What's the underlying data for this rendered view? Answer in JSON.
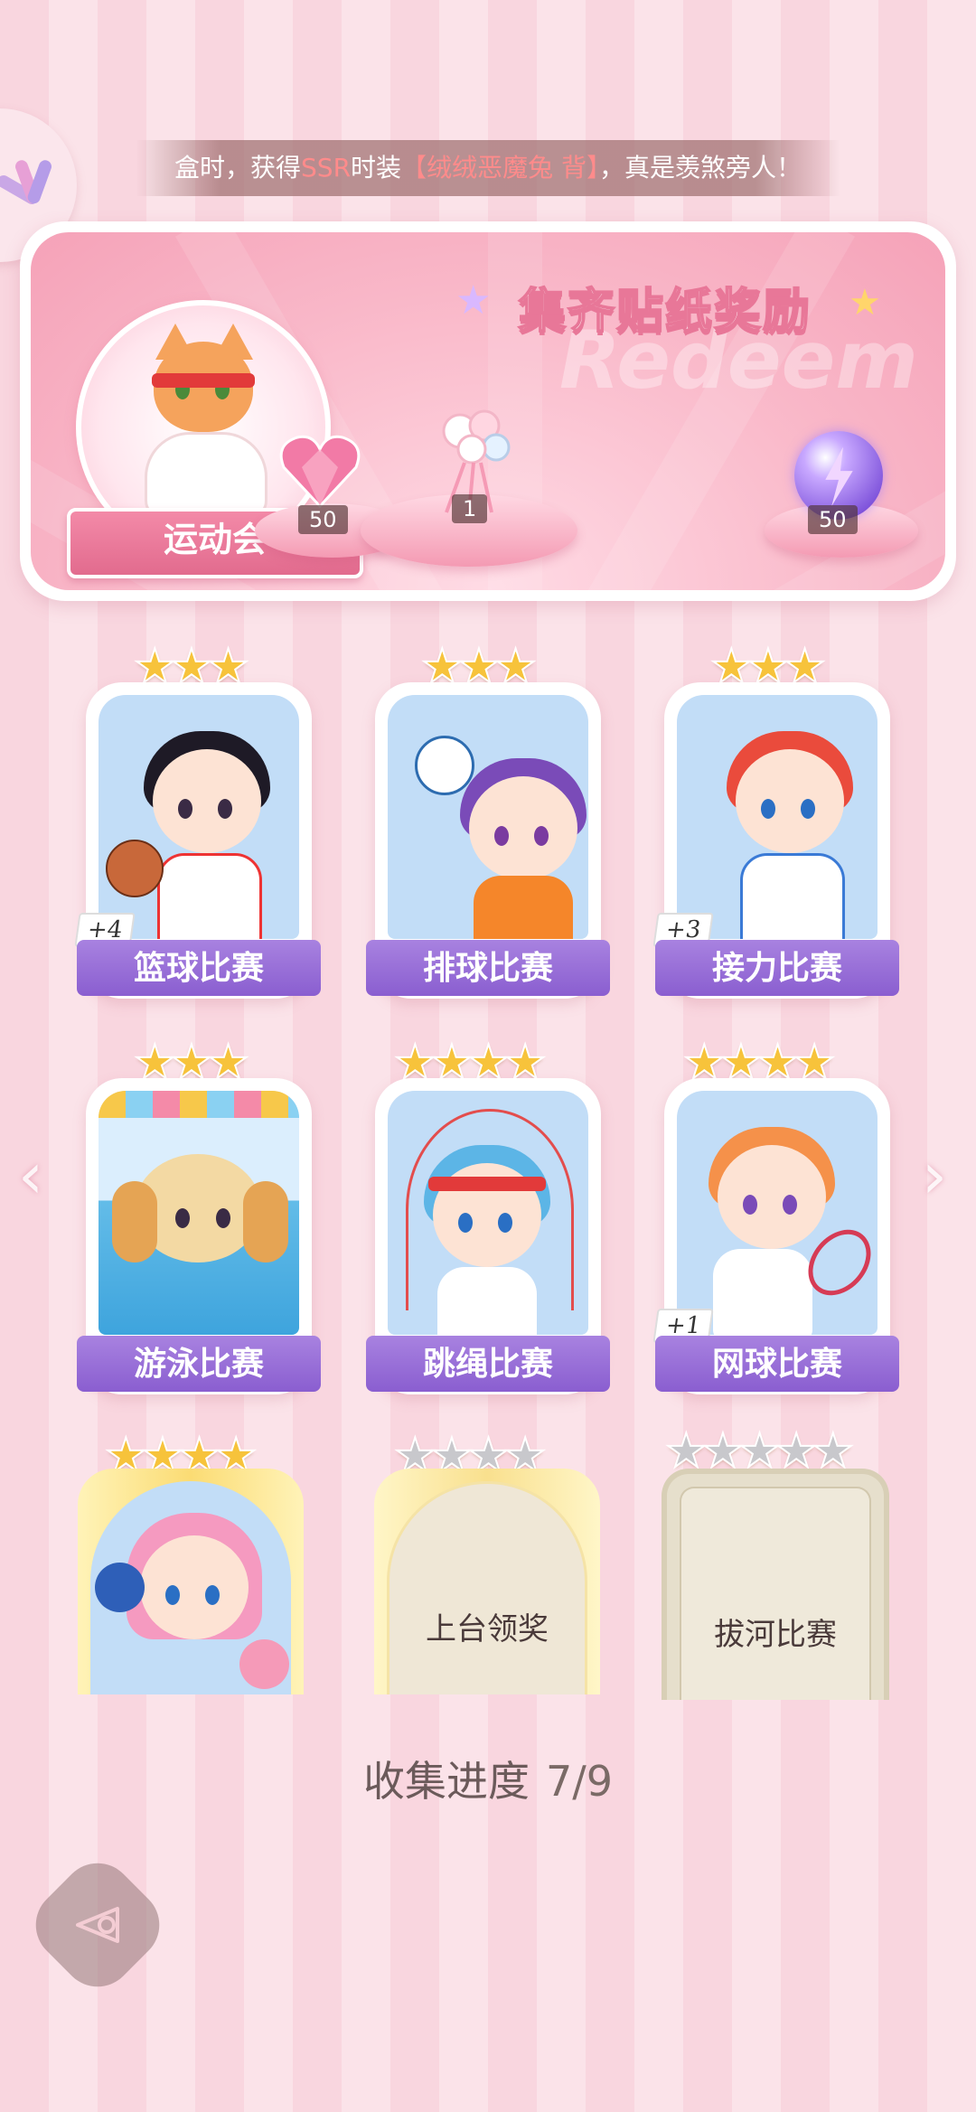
{
  "ticker": {
    "part1": "盒时，获得",
    "part2": "SSR",
    "part3": "时装",
    "part4": "【绒绒恶魔兔 背】",
    "part5": "，真是羡煞旁人！"
  },
  "banner": {
    "title": "集齐贴纸奖励",
    "bg_word": "Redeem",
    "event_name": "运动会",
    "rewards": [
      {
        "icon": "pink-heart-gem-icon",
        "qty": "50"
      },
      {
        "icon": "flower-bouquet-icon",
        "qty": "1"
      },
      {
        "icon": "purple-lightning-orb-icon",
        "qty": "50"
      }
    ]
  },
  "cards": [
    {
      "label": "篮球比赛",
      "stars": "★★★",
      "bonus": "+4"
    },
    {
      "label": "排球比赛",
      "stars": "★★★",
      "bonus": ""
    },
    {
      "label": "接力比赛",
      "stars": "★★★",
      "bonus": "+3"
    },
    {
      "label": "游泳比赛",
      "stars": "★★★",
      "bonus": ""
    },
    {
      "label": "跳绳比赛",
      "stars": "★★★★",
      "bonus": ""
    },
    {
      "label": "网球比赛",
      "stars": "★★★★",
      "bonus": "+1"
    },
    {
      "label": "",
      "stars": "★★★★",
      "bonus": ""
    },
    {
      "label": "上台领奖",
      "stars": "★★★★",
      "bonus": "",
      "locked": true
    },
    {
      "label": "拔河比赛",
      "stars": "★★★★★",
      "bonus": "",
      "locked": true
    }
  ],
  "progress": {
    "label": "收集进度",
    "value": "7/9"
  },
  "nav": {
    "prev": "‹",
    "next": "›"
  },
  "colors": {
    "accent": "#8a5ed0",
    "star": "#f7c33b",
    "pink": "#f49ab3"
  }
}
